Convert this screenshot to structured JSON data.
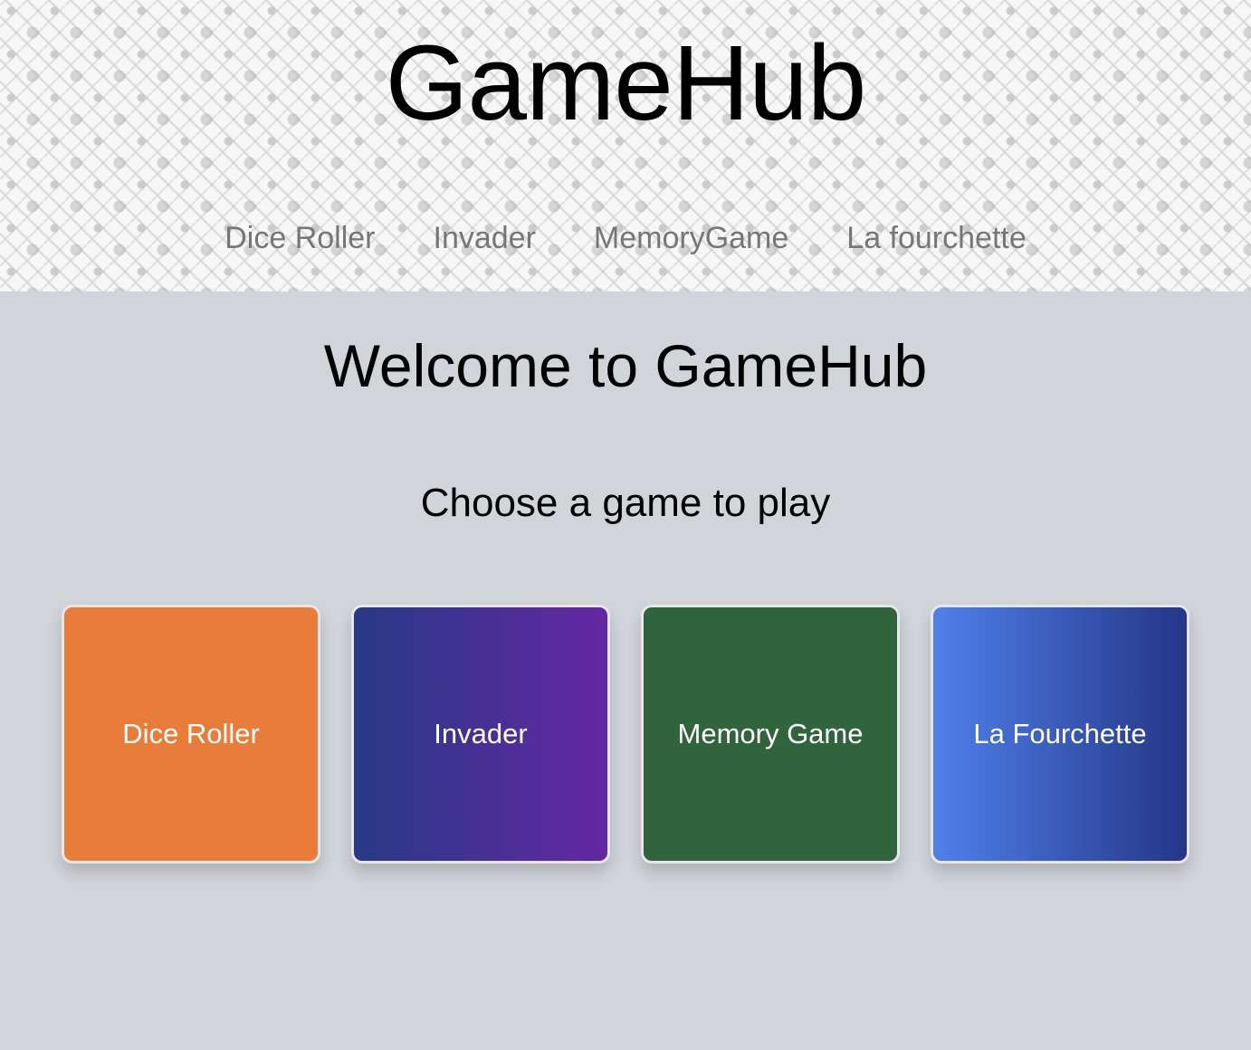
{
  "header": {
    "title": "GameHub",
    "nav": [
      {
        "label": "Dice Roller"
      },
      {
        "label": "Invader"
      },
      {
        "label": "MemoryGame"
      },
      {
        "label": "La fourchette"
      }
    ]
  },
  "main": {
    "heading": "Welcome to GameHub",
    "subheading": "Choose a game to play",
    "cards": [
      {
        "label": "Dice Roller",
        "color_start": "#e87c3a",
        "color_end": "#e87c3a"
      },
      {
        "label": "Invader",
        "color_start": "#283a86",
        "color_end": "#6427a2"
      },
      {
        "label": "Memory Game",
        "color_start": "#31643c",
        "color_end": "#31643c"
      },
      {
        "label": "La Fourchette",
        "color_start": "#4f80ea",
        "color_end": "#253687"
      }
    ]
  },
  "colors": {
    "page_background": "#d1d4d9",
    "nav_text": "#767676"
  }
}
